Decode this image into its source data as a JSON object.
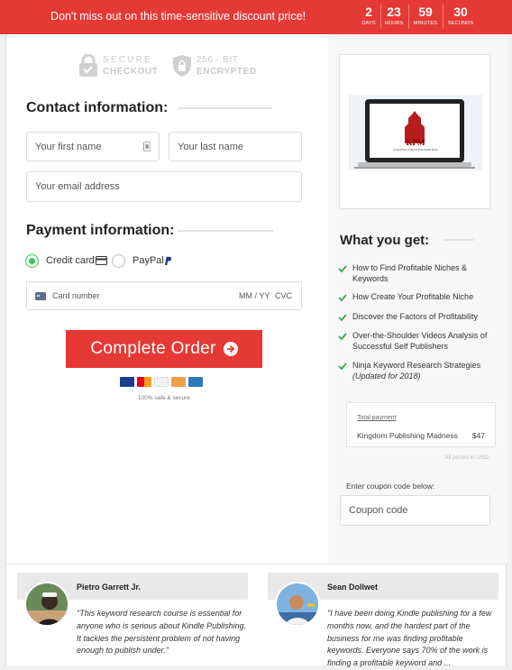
{
  "topbar": {
    "message": "Don't miss out on this time-sensitive discount price!",
    "countdown": [
      {
        "value": "2",
        "label": "DAYS"
      },
      {
        "value": "23",
        "label": "HOURS"
      },
      {
        "value": "59",
        "label": "MINUTES"
      },
      {
        "value": "30",
        "label": "SECONDS"
      }
    ]
  },
  "badges": {
    "secure_line1": "SECURE",
    "secure_line2": "CHECKOUT",
    "encrypted_line1": "256 - BIT",
    "encrypted_line2": "ENCRYPTED"
  },
  "contact": {
    "heading": "Contact information:",
    "first_name_placeholder": "Your first name",
    "last_name_placeholder": "Your last name",
    "email_placeholder": "Your email address"
  },
  "payment": {
    "heading": "Payment information:",
    "options": [
      {
        "label": "Credit card",
        "selected": true,
        "icon": "credit-card-icon"
      },
      {
        "label": "PayPal",
        "selected": false,
        "icon": "paypal-icon"
      }
    ],
    "card_number_placeholder": "Card number",
    "expiry_placeholder": "MM / YY",
    "cvc_placeholder": "CVC",
    "accepted_cards": [
      "visa-icon",
      "mastercard-icon",
      "discover-icon",
      "amex-icon"
    ]
  },
  "order": {
    "button_label": "Complete Order",
    "safe_text": "100% safe & secure"
  },
  "summary": {
    "heading": "What you get:",
    "items": [
      {
        "text": "How to Find Profitable Niches & Keywords"
      },
      {
        "text": "How Create Your Profitable Niche"
      },
      {
        "text": "Discover the Factors of Profitability"
      },
      {
        "text": "Over-the-Shoulder Videos Analysis of Successful Self Publishers"
      },
      {
        "text": "Ninja Keyword Research Strategies",
        "note": "(Updated for 2018)"
      }
    ],
    "total_label": "Total payment",
    "product_name": "Kingdom Publishing Madness",
    "price": "$47",
    "currency_note": "All prices in USD",
    "coupon_label": "Enter coupon code below:",
    "coupon_placeholder": "Coupon code"
  },
  "product_image": {
    "logo_text": "KPM",
    "logo_subtext": "KINGDOM PUBLISHING MADNESS"
  },
  "testimonials": [
    {
      "name": "Pietro Garrett Jr.",
      "quote": "\"This keyword research course is essential for anyone who is serious about Kindle Publishing. It tackles the persistent problem of not having enough to publish under.\""
    },
    {
      "name": "Sean Dollwet",
      "quote": "\"I have been doing Kindle publishing for a few months now, and the hardest part of the business for me was finding profitable keywords. Everyone says 70% of the work is finding a profitable keyword and ..."
    }
  ],
  "colors": {
    "accent": "#e53935",
    "check": "#34a853",
    "radio_on": "#34c759"
  }
}
